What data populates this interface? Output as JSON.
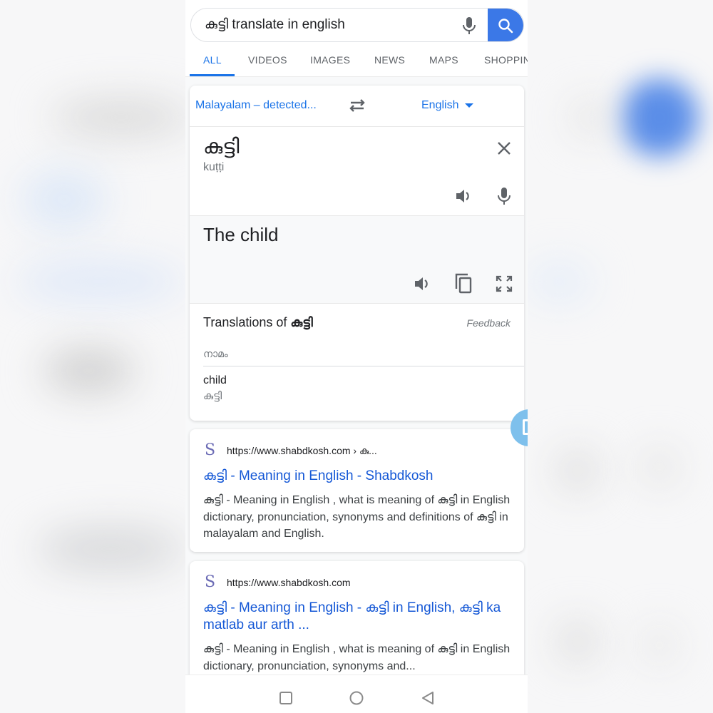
{
  "search": {
    "query": "കുട്ടി translate in english",
    "mic_icon": "mic-icon",
    "search_icon": "search-icon"
  },
  "tabs": [
    {
      "label": "ALL",
      "active": true
    },
    {
      "label": "VIDEOS",
      "active": false
    },
    {
      "label": "IMAGES",
      "active": false
    },
    {
      "label": "NEWS",
      "active": false
    },
    {
      "label": "MAPS",
      "active": false
    },
    {
      "label": "SHOPPIN",
      "active": false
    }
  ],
  "translate": {
    "source_lang": "Malayalam – detected...",
    "target_lang": "English",
    "source_text": "കുട്ടി",
    "transliteration": "kuṭṭi",
    "target_text": "The child",
    "translations_title_prefix": "Translations of ",
    "translations_title_word": "കുട്ടി",
    "feedback": "Feedback",
    "part_of_speech": "നാമം",
    "entries": [
      {
        "word": "child",
        "back_translation": "കുട്ടി"
      }
    ],
    "icons": [
      "swap-icon",
      "close-icon",
      "speaker-icon",
      "mic-icon",
      "copy-icon",
      "fullscreen-icon"
    ]
  },
  "results": [
    {
      "favicon": "S",
      "url": "https://www.shabdkosh.com › കു...",
      "title": "കുട്ടി - Meaning in English - Shabdkosh",
      "snippet": "കുട്ടി - Meaning in English , what is meaning of കുട്ടി in English dictionary, pronunciation, synonyms and definitions of കുട്ടി in malayalam and English."
    },
    {
      "favicon": "S",
      "url": "https://www.shabdkosh.com",
      "title": "കുട്ടി - Meaning in English - കുട്ടി in English, കുട്ടി ka matlab aur arth ...",
      "snippet": "കുട്ടി - Meaning in English , what is meaning of കുട്ടി in English dictionary, pronunciation, synonyms and..."
    }
  ],
  "navbar": {
    "buttons": [
      "recents-icon",
      "home-icon",
      "back-icon"
    ]
  },
  "colors": {
    "accent": "#1a73e8",
    "search_button": "#3b78e7",
    "link": "#1558d6",
    "floating_button": "#7ec0ec"
  }
}
